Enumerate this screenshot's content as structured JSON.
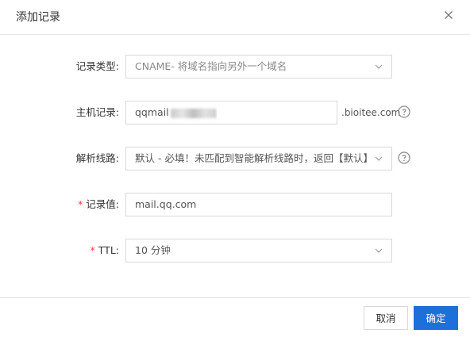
{
  "dialog": {
    "title": "添加记录",
    "close_icon": "close-icon"
  },
  "form": {
    "record_type": {
      "label": "记录类型:",
      "value": "CNAME- 将域名指向另外一个域名"
    },
    "host": {
      "label": "主机记录:",
      "value": "qqmail",
      "suffix": ".bioitee.com"
    },
    "line": {
      "label": "解析线路:",
      "value": "默认 - 必填！未匹配到智能解析线路时，返回【默认】..."
    },
    "record_value": {
      "label": "记录值:",
      "required_mark": "*",
      "value": "mail.qq.com"
    },
    "ttl": {
      "label": "TTL:",
      "required_mark": "*",
      "value": "10 分钟"
    }
  },
  "footer": {
    "cancel_label": "取消",
    "ok_label": "确定"
  },
  "colors": {
    "primary": "#1e6fd9",
    "required": "#e0393e",
    "border": "#d9d9d9"
  }
}
